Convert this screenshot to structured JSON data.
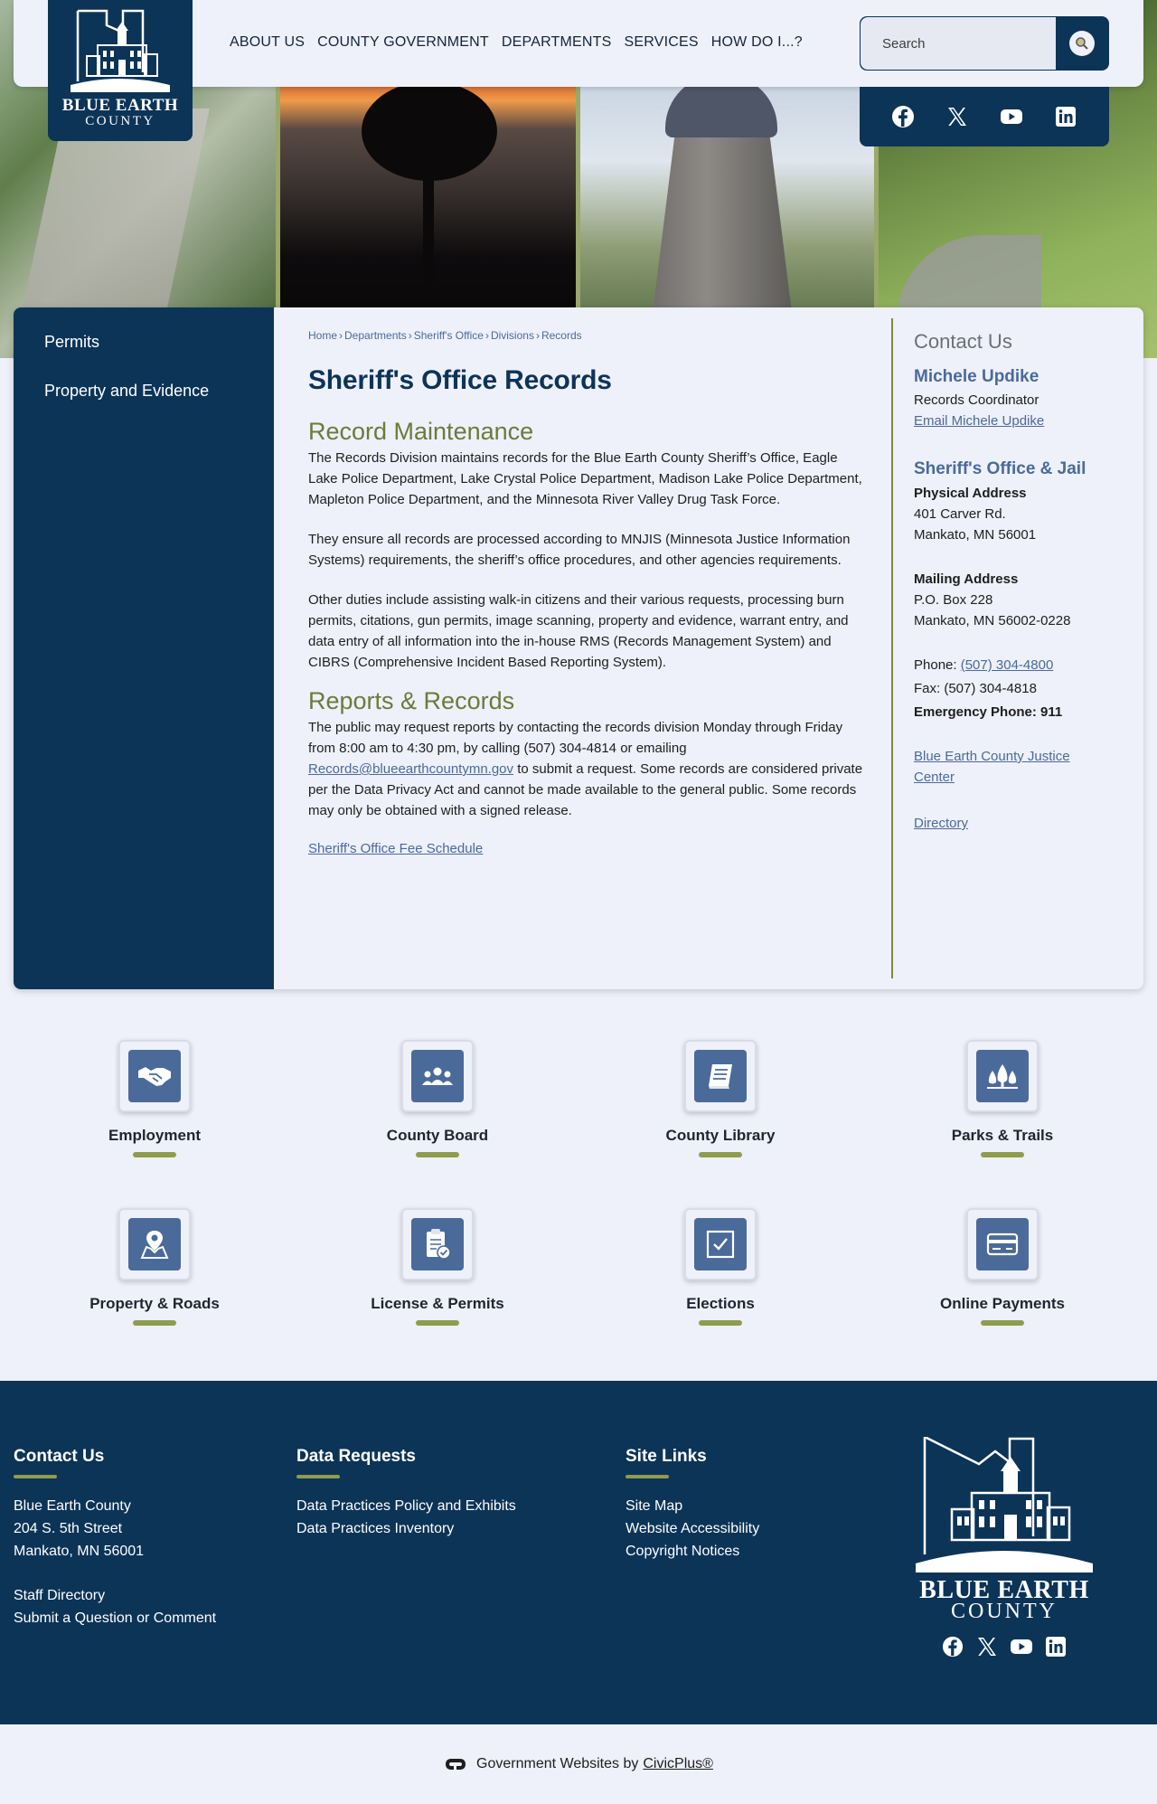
{
  "header": {
    "logo": {
      "name": "BLUE EARTH",
      "sub": "COUNTY"
    },
    "nav": [
      "ABOUT US",
      "COUNTY GOVERNMENT",
      "DEPARTMENTS",
      "SERVICES",
      "HOW DO I...?"
    ],
    "search": {
      "placeholder": "Search"
    },
    "social": [
      "facebook-icon",
      "x-icon",
      "youtube-icon",
      "linkedin-icon"
    ]
  },
  "sidebar": {
    "items": [
      {
        "label": "Permits"
      },
      {
        "label": "Property and Evidence"
      }
    ]
  },
  "breadcrumb": [
    "Home",
    "Departments",
    "Sheriff's Office",
    "Divisions",
    "Records"
  ],
  "main": {
    "title": "Sheriff's Office Records",
    "sections": [
      {
        "heading": "Record Maintenance",
        "paragraphs": [
          "The Records Division maintains records for the Blue Earth County Sheriff’s Office, Eagle Lake Police Department, Lake Crystal Police Department, Madison Lake Police Department, Mapleton Police Department, and the Minnesota River Valley Drug Task Force.",
          "They ensure all records are processed according to MNJIS (Minnesota Justice Information Systems) requirements, the sheriff’s office procedures, and other agencies requirements.",
          "Other duties include assisting walk-in citizens and their various requests, processing burn permits, citations, gun permits, image scanning, property and evidence, warrant entry, and data entry of all information into the in-house RMS (Records Management System) and CIBRS (Comprehensive Incident Based Reporting System)."
        ]
      },
      {
        "heading": "Reports & Records",
        "paragraph_before": "The public may request reports by contacting the records division Monday through Friday from 8:00 am to 4:30 pm, by calling (507) 304-4814 or emailing",
        "email_link": "Records@blueearthcountymn.gov",
        "paragraph_after": "to submit a request. Some records are considered private per the Data Privacy Act and cannot be made available to the general public. Some records may only be obtained with a signed release."
      }
    ],
    "fee_link": "Sheriff's Office Fee Schedule"
  },
  "aside": {
    "title": "Contact Us",
    "person": {
      "name": "Michele Updike",
      "role": "Records Coordinator",
      "email_link": "Email Michele Updike"
    },
    "office": {
      "name": "Sheriff's Office & Jail",
      "physical_label": "Physical Address",
      "physical": [
        "401 Carver Rd.",
        "Mankato, MN 56001"
      ],
      "mailing_label": "Mailing Address",
      "mailing": [
        "P.O. Box 228",
        "Mankato, MN 56002-0228"
      ],
      "phone_label": "Phone:",
      "phone": "(507) 304-4800",
      "fax": "Fax: (507) 304-4818",
      "emergency": "Emergency Phone: 911"
    },
    "links": [
      "Blue Earth County Justice Center",
      "Directory"
    ]
  },
  "quick_links": [
    {
      "label": "Employment",
      "icon": "handshake-icon"
    },
    {
      "label": "County Board",
      "icon": "people-group-icon"
    },
    {
      "label": "County Library",
      "icon": "book-icon"
    },
    {
      "label": "Parks & Trails",
      "icon": "trees-icon"
    },
    {
      "label": "Property & Roads",
      "icon": "map-pin-icon"
    },
    {
      "label": "License & Permits",
      "icon": "clipboard-check-icon"
    },
    {
      "label": "Elections",
      "icon": "checkbox-icon"
    },
    {
      "label": "Online Payments",
      "icon": "credit-card-icon"
    }
  ],
  "footer": {
    "contact": {
      "title": "Contact Us",
      "address": [
        "Blue Earth County",
        "204 S. 5th Street",
        "Mankato, MN 56001"
      ],
      "links": [
        "Staff Directory",
        "Submit a Question or Comment"
      ]
    },
    "data_requests": {
      "title": "Data Requests",
      "links": [
        "Data Practices Policy and Exhibits",
        "Data Practices Inventory"
      ]
    },
    "site_links": {
      "title": "Site Links",
      "links": [
        "Site Map",
        "Website Accessibility",
        "Copyright Notices"
      ]
    },
    "logo": {
      "name": "BLUE EARTH",
      "sub": "COUNTY"
    }
  },
  "bottom": {
    "text": "Government Websites by",
    "link": "CivicPlus®"
  },
  "colors": {
    "navy": "#0c3457",
    "olive": "#6d7a3a",
    "link": "#4a6a9a",
    "accent_bar": "#8f9c4e",
    "background": "#eef0fa"
  }
}
